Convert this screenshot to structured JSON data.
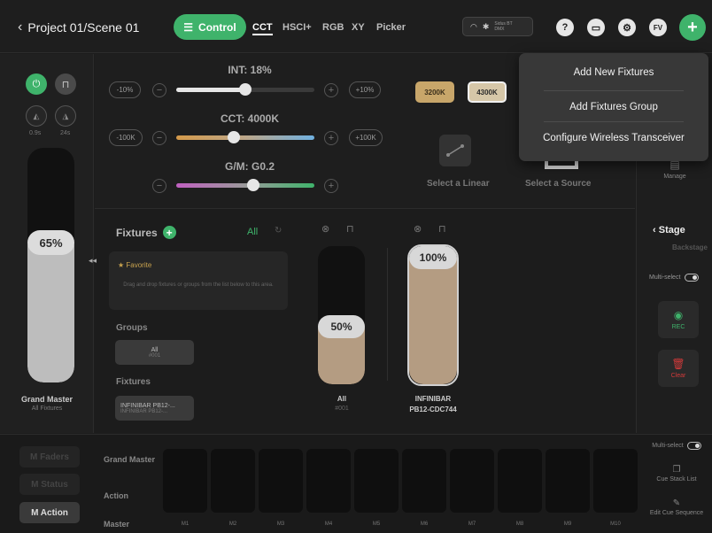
{
  "header": {
    "back_title": "Project 01/Scene 01",
    "control_label": "Control",
    "modes": [
      "CCT",
      "HSCI+",
      "RGB",
      "XY",
      "Picker"
    ],
    "connection_line1": "Sidus BT",
    "connection_line2": "DMX",
    "user_initials": "FV",
    "plus": "+"
  },
  "left": {
    "fade_times": [
      "0.9s",
      "24s"
    ],
    "grand_master_value": "65%",
    "grand_master_fraction": 0.65,
    "grand_master_label": "Grand Master",
    "grand_master_sub": "All Fixtures"
  },
  "controls": {
    "int_title": "INT: 18%",
    "int_fraction": 0.5,
    "int_minus": "-10%",
    "int_plus": "+10%",
    "cct_title": "CCT: 4000K",
    "cct_minus": "-100K",
    "cct_plus": "+100K",
    "gm_title": "G/M: G0.2",
    "presets": [
      "3200K",
      "4300K"
    ],
    "select_linear": "Select a Linear",
    "select_source": "Select a Source"
  },
  "fixtures_panel": {
    "title": "Fixtures",
    "all_filter": "All",
    "favorite_title": "★ Favorite",
    "favorite_hint": "Drag and drop fixtures or groups from the list below to this area.",
    "groups_label": "Groups",
    "group_chip": {
      "name": "All",
      "id": "#001"
    },
    "fixtures_label": "Fixtures",
    "fixture_chip": {
      "name": "INFINIBAR PB12-...",
      "sub": "INFINIBAR PB12-..."
    }
  },
  "faders": [
    {
      "value": "50%",
      "fraction": 0.5,
      "name": "All",
      "sub": "#001"
    },
    {
      "value": "100%",
      "fraction": 1.0,
      "name": "INFINIBAR",
      "sub": "PB12-CDC744"
    }
  ],
  "right": {
    "manage": "Manage",
    "stage": "Stage",
    "backstage": "Backstage",
    "multiselect": "Multi-select",
    "rec": "REC",
    "clear": "Clear"
  },
  "bottom": {
    "modes": [
      "M Faders",
      "M Status",
      "M Action"
    ],
    "row_labels": [
      "Grand Master",
      "Action",
      "Master"
    ],
    "cues": [
      "M1",
      "M2",
      "M3",
      "M4",
      "M5",
      "M6",
      "M7",
      "M8",
      "M9",
      "M10"
    ],
    "multiselect": "Multi-select",
    "cue_stack": "Cue Stack List",
    "edit_cue": "Edit Cue Sequence"
  },
  "dropdown": {
    "items": [
      "Add New Fixtures",
      "Add Fixtures Group",
      "Configure Wireless Transceiver"
    ]
  },
  "colors": {
    "accent_green": "#3fb36b",
    "preset_gold": "#c8a66a",
    "fader_fill": "#b49c82",
    "rec_green": "#3fb36b",
    "clear_red": "#d23a3a"
  }
}
